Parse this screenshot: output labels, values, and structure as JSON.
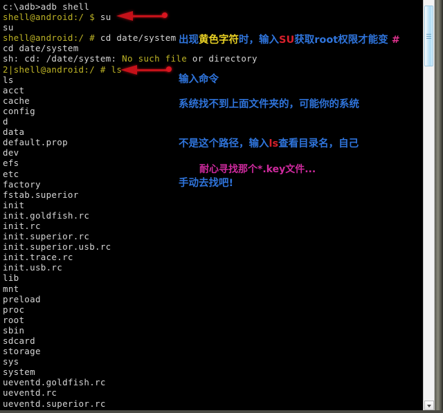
{
  "window": {
    "title": "adb shell console",
    "background_color": "#000000",
    "text_color": "#d6d6d6",
    "prompt_color": "#bdb326"
  },
  "console": {
    "lines": [
      {
        "segments": [
          {
            "text": "c:\\adb>adb shell",
            "style": "w"
          }
        ]
      },
      {
        "segments": [
          {
            "text": "shell@android:/ $",
            "style": "y"
          },
          {
            "text": " su",
            "style": "w"
          }
        ]
      },
      {
        "segments": [
          {
            "text": "su",
            "style": "w"
          }
        ]
      },
      {
        "segments": [
          {
            "text": "shell@android:/ #",
            "style": "y"
          },
          {
            "text": " cd date/system",
            "style": "w"
          }
        ]
      },
      {
        "segments": [
          {
            "text": "cd date/system",
            "style": "w"
          }
        ]
      },
      {
        "segments": [
          {
            "text": "sh: cd: /date/system: ",
            "style": "w"
          },
          {
            "text": "No such file",
            "style": "y"
          },
          {
            "text": " or directory",
            "style": "w"
          }
        ]
      },
      {
        "segments": [
          {
            "text": "2|shell@android:/ #",
            "style": "y"
          },
          {
            "text": " ",
            "style": "w"
          },
          {
            "text": "ls",
            "style": "y"
          }
        ]
      },
      {
        "segments": [
          {
            "text": "ls",
            "style": "w"
          }
        ]
      },
      {
        "segments": [
          {
            "text": "acct",
            "style": "w"
          }
        ]
      },
      {
        "segments": [
          {
            "text": "cache",
            "style": "w"
          }
        ]
      },
      {
        "segments": [
          {
            "text": "config",
            "style": "w"
          }
        ]
      },
      {
        "segments": [
          {
            "text": "d",
            "style": "w"
          }
        ]
      },
      {
        "segments": [
          {
            "text": "data",
            "style": "w"
          }
        ]
      },
      {
        "segments": [
          {
            "text": "default.prop",
            "style": "w"
          }
        ]
      },
      {
        "segments": [
          {
            "text": "dev",
            "style": "w"
          }
        ]
      },
      {
        "segments": [
          {
            "text": "efs",
            "style": "w"
          }
        ]
      },
      {
        "segments": [
          {
            "text": "etc",
            "style": "w"
          }
        ]
      },
      {
        "segments": [
          {
            "text": "factory",
            "style": "w"
          }
        ]
      },
      {
        "segments": [
          {
            "text": "fstab.superior",
            "style": "w"
          }
        ]
      },
      {
        "segments": [
          {
            "text": "init",
            "style": "w"
          }
        ]
      },
      {
        "segments": [
          {
            "text": "init.goldfish.rc",
            "style": "w"
          }
        ]
      },
      {
        "segments": [
          {
            "text": "init.rc",
            "style": "w"
          }
        ]
      },
      {
        "segments": [
          {
            "text": "init.superior.rc",
            "style": "w"
          }
        ]
      },
      {
        "segments": [
          {
            "text": "init.superior.usb.rc",
            "style": "w"
          }
        ]
      },
      {
        "segments": [
          {
            "text": "init.trace.rc",
            "style": "w"
          }
        ]
      },
      {
        "segments": [
          {
            "text": "init.usb.rc",
            "style": "w"
          }
        ]
      },
      {
        "segments": [
          {
            "text": "lib",
            "style": "w"
          }
        ]
      },
      {
        "segments": [
          {
            "text": "mnt",
            "style": "w"
          }
        ]
      },
      {
        "segments": [
          {
            "text": "preload",
            "style": "w"
          }
        ]
      },
      {
        "segments": [
          {
            "text": "proc",
            "style": "w"
          }
        ]
      },
      {
        "segments": [
          {
            "text": "root",
            "style": "w"
          }
        ]
      },
      {
        "segments": [
          {
            "text": "sbin",
            "style": "w"
          }
        ]
      },
      {
        "segments": [
          {
            "text": "sdcard",
            "style": "w"
          }
        ]
      },
      {
        "segments": [
          {
            "text": "storage",
            "style": "w"
          }
        ]
      },
      {
        "segments": [
          {
            "text": "sys",
            "style": "w"
          }
        ]
      },
      {
        "segments": [
          {
            "text": "system",
            "style": "w"
          }
        ]
      },
      {
        "segments": [
          {
            "text": "ueventd.goldfish.rc",
            "style": "w"
          }
        ]
      },
      {
        "segments": [
          {
            "text": "ueventd.rc",
            "style": "w"
          }
        ]
      },
      {
        "segments": [
          {
            "text": "ueventd.superior.rc",
            "style": "w"
          }
        ]
      }
    ]
  },
  "annotations": {
    "note1": {
      "line1": [
        {
          "text": "出现",
          "color": "blue"
        },
        {
          "text": "黄色字符",
          "color": "yellow"
        },
        {
          "text": "时，输入",
          "color": "blue"
        },
        {
          "text": "SU",
          "color": "red"
        },
        {
          "text": "获取root权限才能变 ",
          "color": "blue"
        },
        {
          "text": "#",
          "color": "pink"
        }
      ],
      "line2": [
        {
          "text": "输入命令",
          "color": "blue"
        }
      ]
    },
    "note2": {
      "line1": [
        {
          "text": "系统找不到上面文件夹的，可能你的系统",
          "color": "blue"
        }
      ],
      "line2": [
        {
          "text": "不是这个路径，输入",
          "color": "blue"
        },
        {
          "text": "ls",
          "color": "red"
        },
        {
          "text": "查看目录名，自己",
          "color": "blue"
        }
      ],
      "line3": [
        {
          "text": "手动去找吧!",
          "color": "blue"
        }
      ]
    },
    "note3": {
      "text": "耐心寻找那个*.key文件...",
      "color": "magenta"
    }
  },
  "arrows": [
    {
      "name": "arrow-to-su-prompt",
      "direction": "left",
      "color": "#c41119"
    },
    {
      "name": "arrow-to-ls-command",
      "direction": "left",
      "color": "#c41119"
    }
  ],
  "scrollbar": {
    "orientation": "vertical",
    "thumb_position": "top",
    "down_button_glyph": "▼"
  }
}
